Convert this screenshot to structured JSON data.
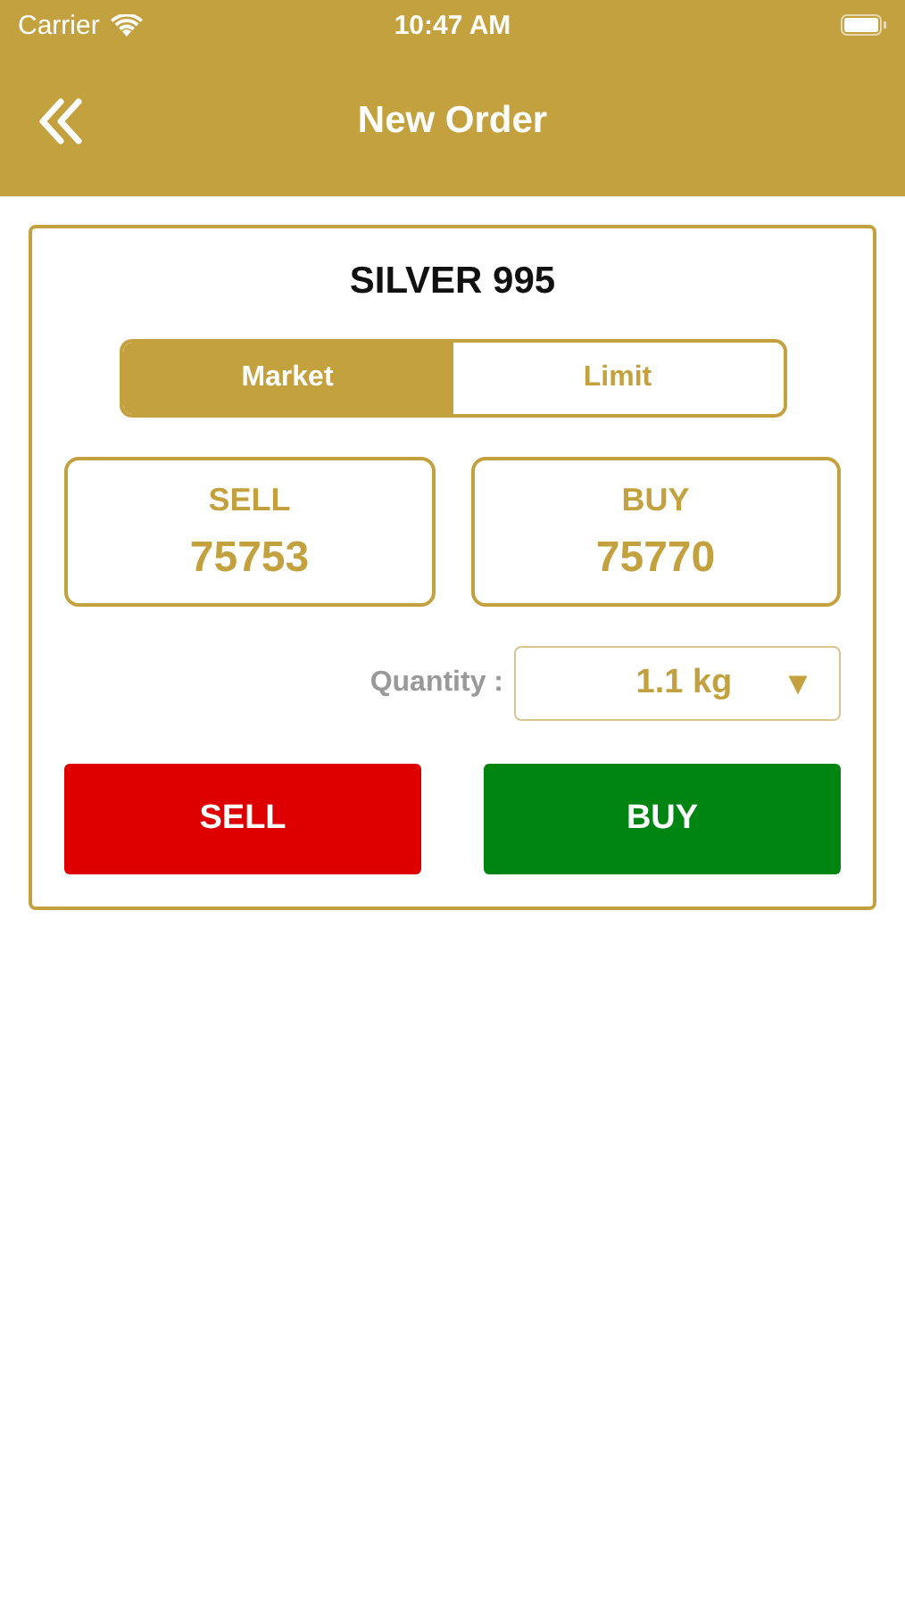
{
  "status_bar": {
    "carrier": "Carrier",
    "time": "10:47 AM"
  },
  "header": {
    "title": "New Order"
  },
  "order": {
    "product": "SILVER 995",
    "tabs": [
      {
        "label": "Market",
        "selected": true
      },
      {
        "label": "Limit",
        "selected": false
      }
    ],
    "quotes": [
      {
        "label": "SELL",
        "price": "75753"
      },
      {
        "label": "BUY",
        "price": "75770"
      }
    ],
    "quantity": {
      "label": "Quantity :",
      "value": "1.1 kg",
      "arrow": "▼"
    },
    "actions": [
      {
        "label": "SELL",
        "kind": "sell"
      },
      {
        "label": "BUY",
        "kind": "buy"
      }
    ]
  }
}
